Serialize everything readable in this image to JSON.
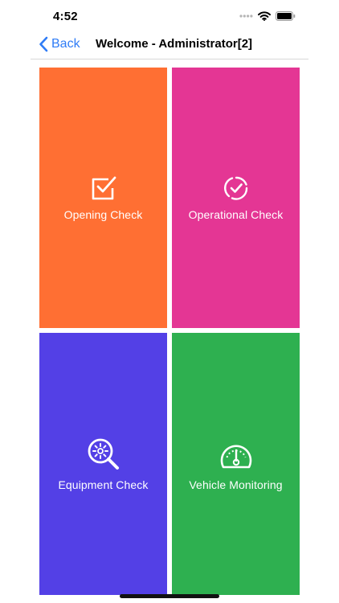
{
  "status_bar": {
    "time": "4:52",
    "icons": [
      "signal-dots-icon",
      "wifi-icon",
      "battery-icon"
    ]
  },
  "nav": {
    "back_label": "Back",
    "title": "Welcome - Administrator[2]",
    "accent_color": "#2f7cf6"
  },
  "tiles": [
    {
      "label": "Opening Check",
      "color": "#ff6f33",
      "icon": "checkbox-icon"
    },
    {
      "label": "Operational Check",
      "color": "#e43694",
      "icon": "circle-check-icon"
    },
    {
      "label": "Equipment Check",
      "color": "#5340e6",
      "icon": "magnifier-gear-icon"
    },
    {
      "label": "Vehicle Monitoring",
      "color": "#2eb050",
      "icon": "speedometer-icon"
    }
  ]
}
